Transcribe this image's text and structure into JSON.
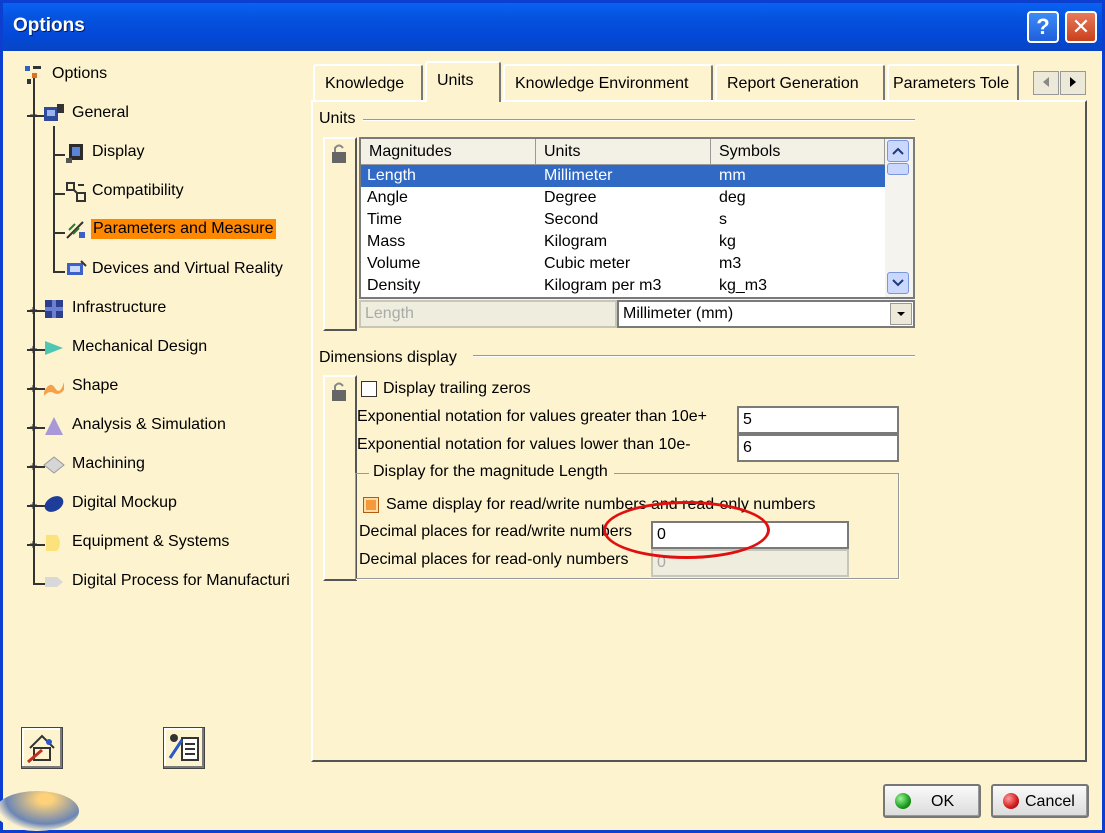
{
  "window": {
    "title": "Options",
    "help_glyph": "?",
    "close_glyph": "✕"
  },
  "tree": {
    "root": {
      "label": "Options",
      "icon": "options-tree-icon"
    },
    "general": {
      "label": "General",
      "icon": "general-icon"
    },
    "general_children": [
      {
        "label": "Display",
        "icon": "display-icon"
      },
      {
        "label": "Compatibility",
        "icon": "compatibility-icon"
      },
      {
        "label": "Parameters and Measure",
        "icon": "parameters-icon",
        "selected": true
      },
      {
        "label": "Devices and Virtual Reality",
        "icon": "devices-icon"
      }
    ],
    "top_items": [
      {
        "label": "Infrastructure",
        "icon": "infrastructure-icon"
      },
      {
        "label": "Mechanical Design",
        "icon": "mechanical-design-icon"
      },
      {
        "label": "Shape",
        "icon": "shape-icon"
      },
      {
        "label": "Analysis & Simulation",
        "icon": "analysis-icon"
      },
      {
        "label": "Machining",
        "icon": "machining-icon"
      },
      {
        "label": "Digital Mockup",
        "icon": "digital-mockup-icon"
      },
      {
        "label": "Equipment & Systems",
        "icon": "equipment-icon"
      },
      {
        "label": "Digital Process for Manufacturi",
        "icon": "digital-process-icon"
      }
    ]
  },
  "tabs": [
    {
      "label": "Knowledge"
    },
    {
      "label": "Units",
      "active": true
    },
    {
      "label": "Knowledge Environment"
    },
    {
      "label": "Report Generation"
    },
    {
      "label": "Parameters Tole"
    }
  ],
  "units_group": {
    "title": "Units",
    "columns": [
      "Magnitudes",
      "Units",
      "Symbols"
    ],
    "rows": [
      [
        "Length",
        "Millimeter",
        "mm"
      ],
      [
        "Angle",
        "Degree",
        "deg"
      ],
      [
        "Time",
        "Second",
        "s"
      ],
      [
        "Mass",
        "Kilogram",
        "kg"
      ],
      [
        "Volume",
        "Cubic meter",
        "m3"
      ],
      [
        "Density",
        "Kilogram per m3",
        "kg_m3"
      ]
    ],
    "selected_row": 0,
    "magnitude_field": "Length",
    "unit_select": "Millimeter (mm)"
  },
  "dimensions_group": {
    "title": "Dimensions display",
    "trailing_zeros_label": "Display trailing zeros",
    "trailing_zeros_checked": false,
    "exp_greater_label": "Exponential notation for values greater than 10e+",
    "exp_greater_value": "5",
    "exp_lower_label": "Exponential notation for values lower than 10e-",
    "exp_lower_value": "6",
    "magnitude_subgroup_title": "Display for the magnitude Length",
    "same_display_label": "Same display for read/write numbers and read-only numbers",
    "same_display_checked": true,
    "decimal_rw_label": "Decimal places for read/write numbers",
    "decimal_rw_value": "0",
    "decimal_ro_label": "Decimal places for read-only numbers",
    "decimal_ro_value": "0"
  },
  "buttons": {
    "ok": "OK",
    "cancel": "Cancel"
  },
  "colors": {
    "selection": "#316ac5",
    "tree_selection": "#ff8800",
    "annotation": "#e01010",
    "background": "#fdf3cf"
  }
}
